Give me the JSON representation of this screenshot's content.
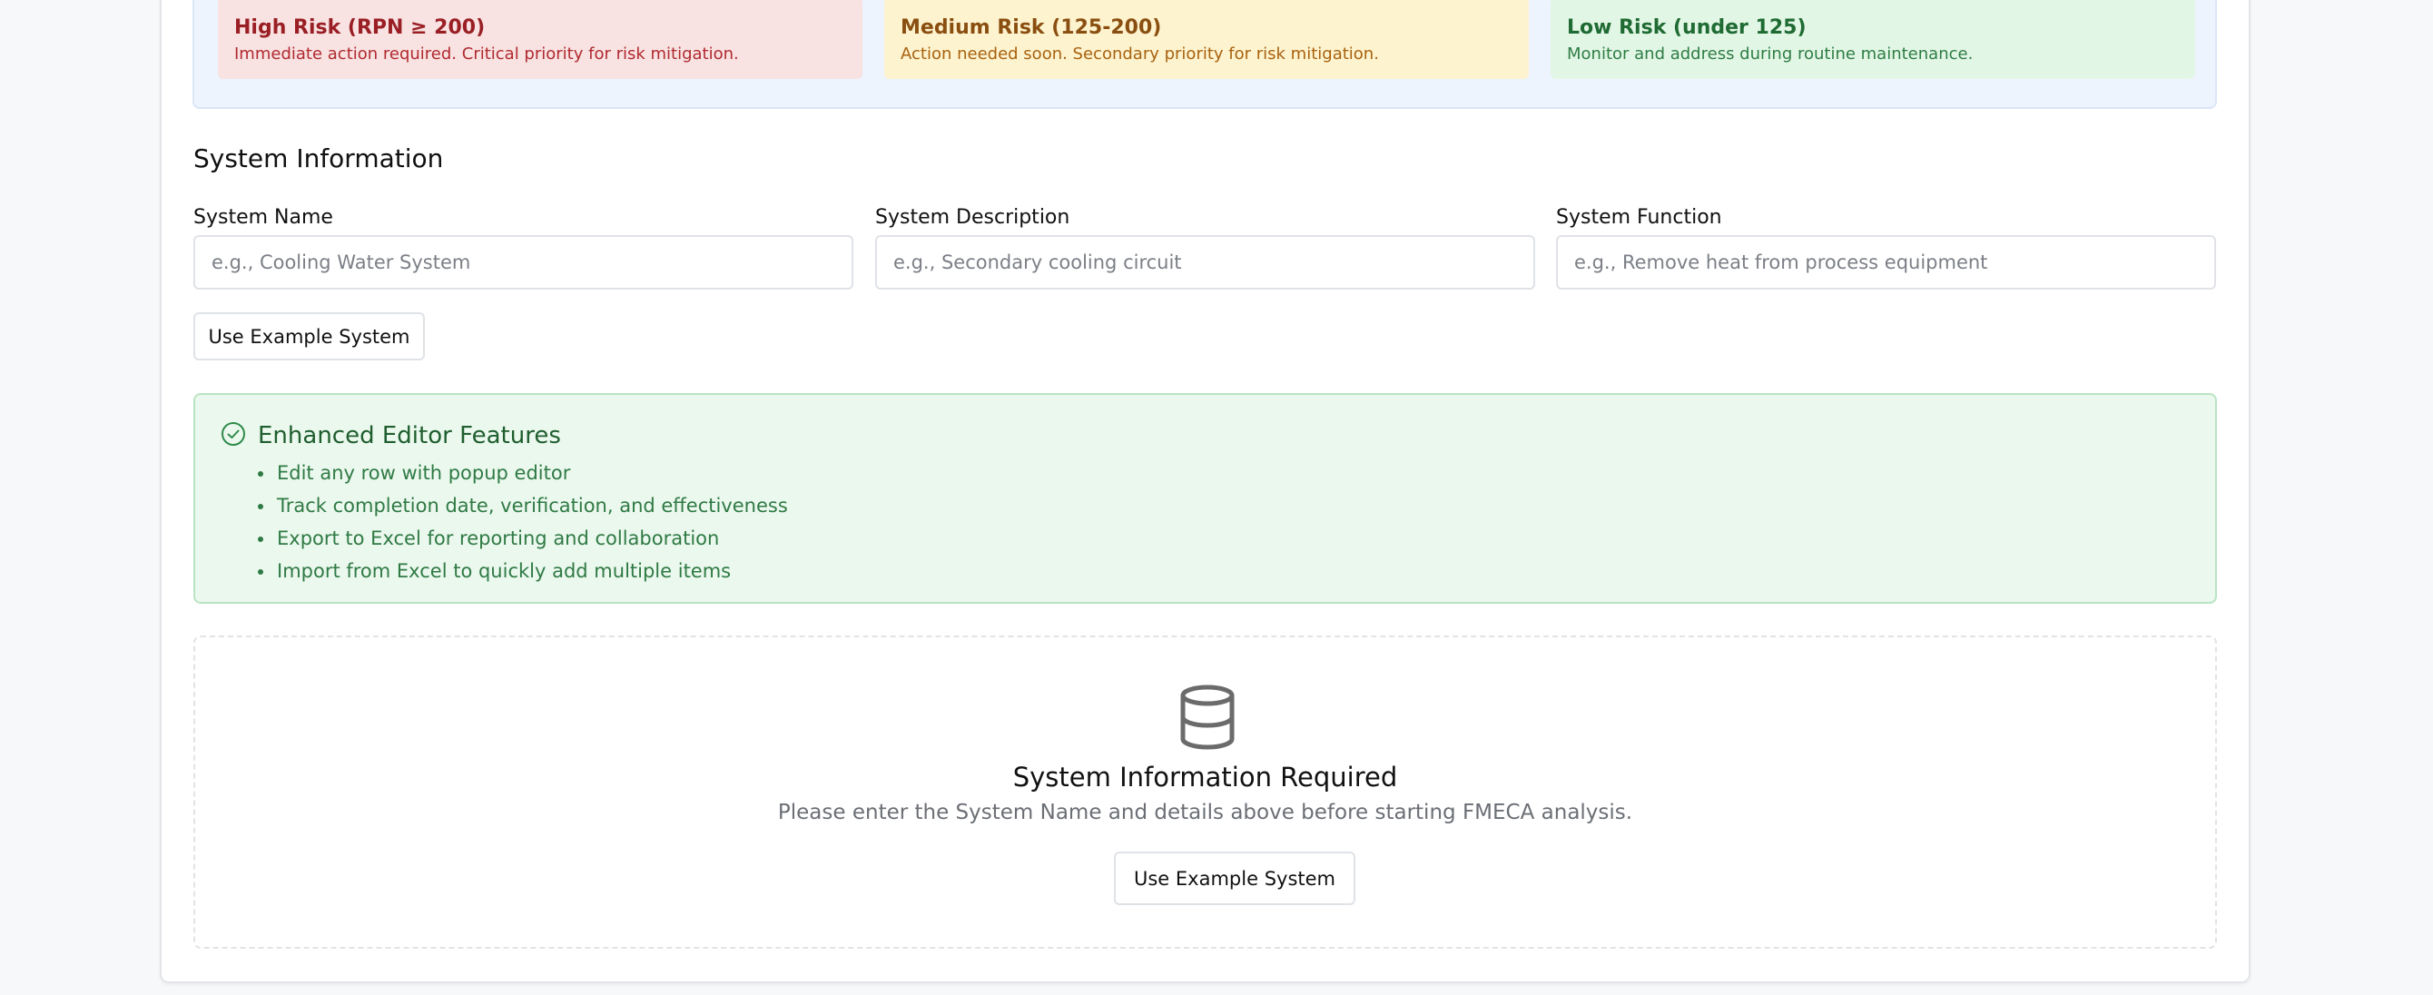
{
  "risk_legend": {
    "high": {
      "title": "High Risk (RPN ≥ 200)",
      "description": "Immediate action required. Critical priority for risk mitigation.",
      "color": "#f8e2e2"
    },
    "medium": {
      "title": "Medium Risk (125-200)",
      "description": "Action needed soon. Secondary priority for risk mitigation.",
      "color": "#fdf3cf"
    },
    "low": {
      "title": "Low Risk (under 125)",
      "description": "Monitor and address during routine maintenance.",
      "color": "#e2f6e6"
    }
  },
  "system_info": {
    "heading": "System Information",
    "fields": {
      "name": {
        "label": "System Name",
        "placeholder": "e.g., Cooling Water System",
        "value": ""
      },
      "description": {
        "label": "System Description",
        "placeholder": "e.g., Secondary cooling circuit",
        "value": ""
      },
      "function": {
        "label": "System Function",
        "placeholder": "e.g., Remove heat from process equipment",
        "value": ""
      }
    },
    "example_button_label": "Use Example System"
  },
  "features": {
    "icon": "check-circle-icon",
    "title": "Enhanced Editor Features",
    "items": [
      "Edit any row with popup editor",
      "Track completion date, verification, and effectiveness",
      "Export to Excel for reporting and collaboration",
      "Import from Excel to quickly add multiple items"
    ]
  },
  "empty_state": {
    "icon": "database-icon",
    "title": "System Information Required",
    "description": "Please enter the System Name and details above before starting FMECA analysis.",
    "button_label": "Use Example System"
  }
}
